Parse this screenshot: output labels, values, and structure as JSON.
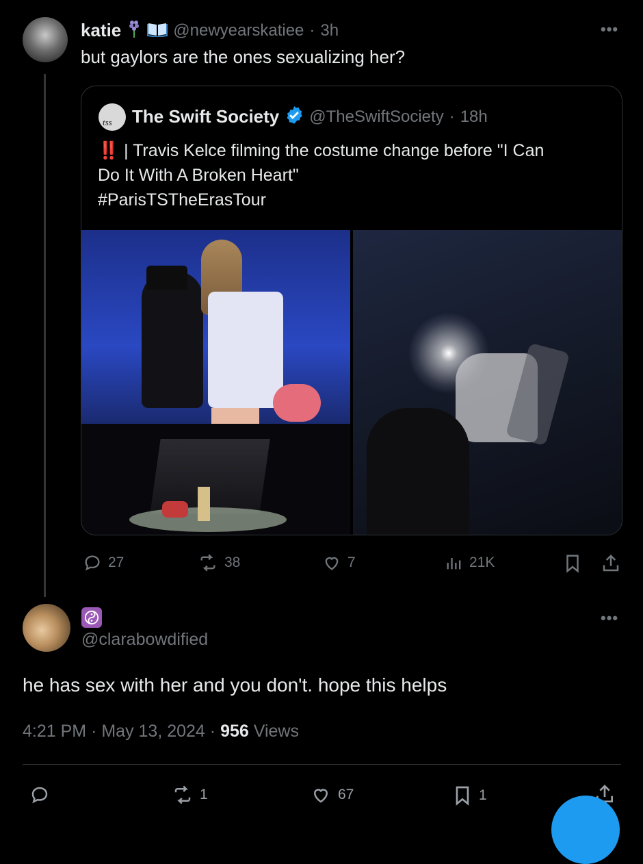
{
  "main_post": {
    "display_name": "katie",
    "emoji_badges": [
      "hyacinth-icon",
      "book-icon"
    ],
    "handle": "@newyearskatiee",
    "time": "3h",
    "text": "but gaylors are the ones sexualizing her?"
  },
  "quoted_post": {
    "avatar_text": "tss",
    "display_name": "The Swift Society",
    "verified": true,
    "handle": "@TheSwiftSociety",
    "time": "18h",
    "emoji": "‼️",
    "text_line1": "| Travis Kelce filming the costume change before \"I Can",
    "text_line2": "Do It With A Broken Heart\"",
    "hashtag": "#ParisTSTheErasTour"
  },
  "main_actions": {
    "replies": "27",
    "reposts": "38",
    "likes": "7",
    "views": "21K"
  },
  "reply_post": {
    "badge_icon": "yin-yang-icon",
    "handle": "@clarabowdified",
    "text": "he has sex with her and you don't. hope this helps",
    "time": "4:21 PM",
    "date": "May 13, 2024",
    "views_count": "956",
    "views_label": "Views"
  },
  "reply_actions": {
    "reposts": "1",
    "likes": "67",
    "bookmarks": "1"
  },
  "colors": {
    "background": "#000000",
    "text": "#e7e9ea",
    "muted": "#71767b",
    "verified": "#1d9bf0",
    "accent": "#1d9bf0"
  }
}
